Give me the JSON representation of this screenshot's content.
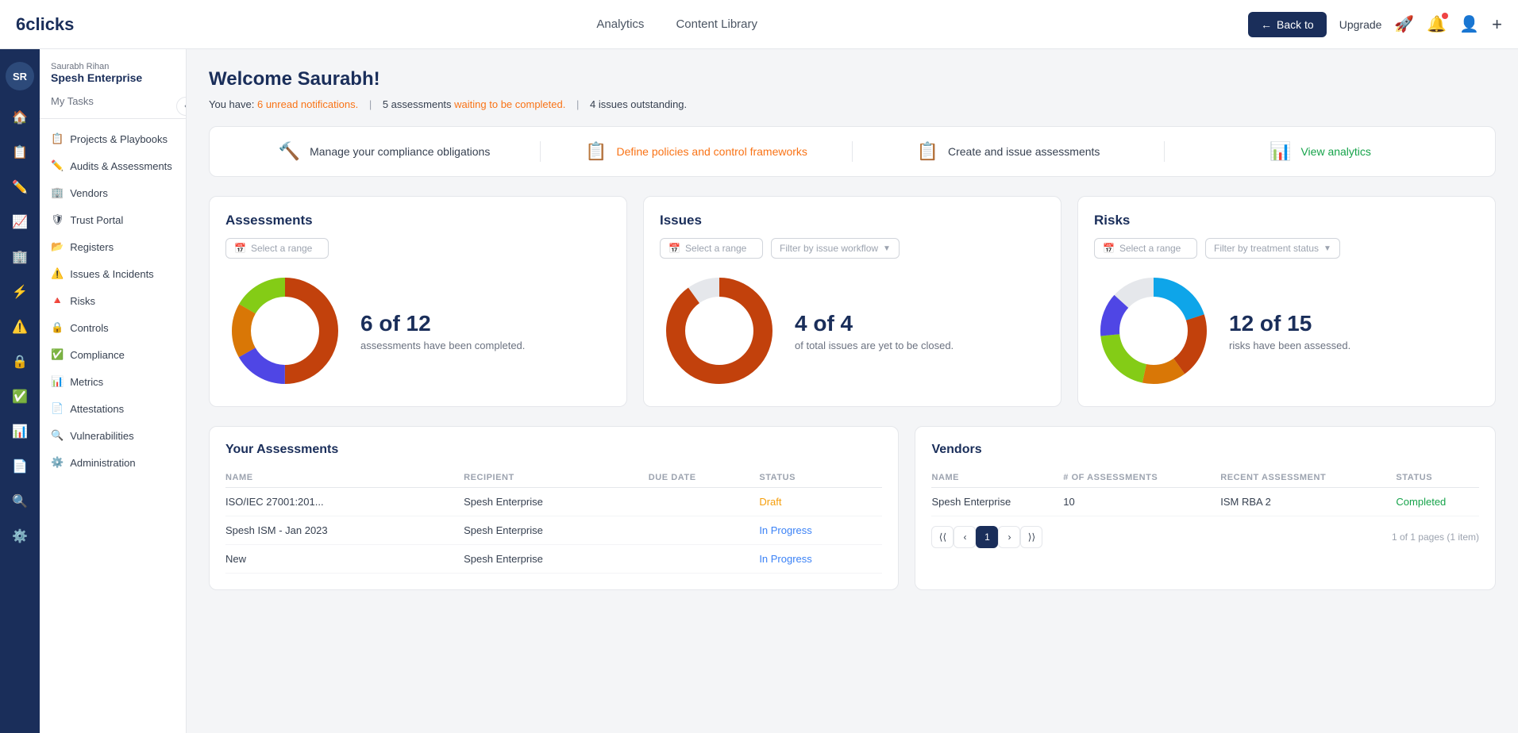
{
  "brand": {
    "name": "6clicks",
    "logo_text": "6clicks"
  },
  "nav": {
    "links": [
      "Analytics",
      "Content Library"
    ],
    "back_btn": "Back to",
    "upgrade_btn": "Upgrade",
    "plus_label": "+"
  },
  "user": {
    "initials": "SR",
    "name": "Saurabh Rihan",
    "org": "Spesh Enterprise",
    "my_tasks": "My Tasks"
  },
  "sidebar_nav": [
    {
      "label": "Projects & Playbooks",
      "icon": "📋"
    },
    {
      "label": "Audits & Assessments",
      "icon": "📝"
    },
    {
      "label": "Vendors",
      "icon": "🏢"
    },
    {
      "label": "Trust Portal",
      "icon": "🛡"
    },
    {
      "label": "Registers",
      "icon": "📂"
    },
    {
      "label": "Issues & Incidents",
      "icon": "⚠️"
    },
    {
      "label": "Risks",
      "icon": "🔺"
    },
    {
      "label": "Controls",
      "icon": "🔒"
    },
    {
      "label": "Compliance",
      "icon": "✅"
    },
    {
      "label": "Metrics",
      "icon": "📊"
    },
    {
      "label": "Attestations",
      "icon": "📄"
    },
    {
      "label": "Vulnerabilities",
      "icon": "🔍"
    },
    {
      "label": "Administration",
      "icon": "⚙️"
    }
  ],
  "welcome": {
    "title": "Welcome Saurabh!",
    "subtitle_prefix": "You have:",
    "notifications": "6 unread notifications.",
    "assessments_waiting": "5 assessments waiting to be completed.",
    "issues_outstanding": "4 issues outstanding."
  },
  "quick_actions": [
    {
      "label": "Manage your compliance obligations",
      "icon": "🔨"
    },
    {
      "label": "Define policies and control frameworks",
      "icon": "📋"
    },
    {
      "label": "Create and issue assessments",
      "icon": "📋"
    },
    {
      "label": "View analytics",
      "icon": "📊"
    }
  ],
  "assessments_card": {
    "title": "Assessments",
    "filter_placeholder": "Select a range",
    "stat_main": "6 of 12",
    "stat_desc": "assessments have been completed.",
    "donut": {
      "segments": [
        {
          "value": 6,
          "color": "#c2410c"
        },
        {
          "value": 2,
          "color": "#4f46e5"
        },
        {
          "value": 2,
          "color": "#d97706"
        },
        {
          "value": 2,
          "color": "#84cc16"
        }
      ]
    }
  },
  "issues_card": {
    "title": "Issues",
    "filter_placeholder": "Select a range",
    "filter2_placeholder": "Filter by issue workflow",
    "stat_main": "4 of 4",
    "stat_desc": "of total issues are yet to be closed.",
    "donut": {
      "segments": [
        {
          "value": 8,
          "color": "#c2410c"
        },
        {
          "value": 2,
          "color": "#e5e7eb"
        }
      ]
    }
  },
  "risks_card": {
    "title": "Risks",
    "filter_placeholder": "Select a range",
    "filter2_placeholder": "Filter by treatment status",
    "stat_main": "12 of 15",
    "stat_desc": "risks have been assessed.",
    "donut": {
      "segments": [
        {
          "value": 3,
          "color": "#0ea5e9"
        },
        {
          "value": 3,
          "color": "#c2410c"
        },
        {
          "value": 2,
          "color": "#d97706"
        },
        {
          "value": 3,
          "color": "#84cc16"
        },
        {
          "value": 2,
          "color": "#4f46e5"
        }
      ]
    }
  },
  "your_assessments": {
    "title": "Your Assessments",
    "columns": [
      "NAME",
      "RECIPIENT",
      "DUE DATE",
      "STATUS"
    ],
    "rows": [
      {
        "name": "ISO/IEC 27001:201...",
        "recipient": "Spesh Enterprise",
        "due_date": "",
        "status": "Draft",
        "status_class": "status-draft"
      },
      {
        "name": "Spesh ISM - Jan 2023",
        "recipient": "Spesh Enterprise",
        "due_date": "",
        "status": "In Progress",
        "status_class": "status-in-progress"
      },
      {
        "name": "New",
        "recipient": "Spesh Enterprise",
        "due_date": "",
        "status": "In Progress",
        "status_class": "status-in-progress"
      }
    ]
  },
  "vendors": {
    "title": "Vendors",
    "columns": [
      "NAME",
      "# OF ASSESSMENTS",
      "RECENT ASSESSMENT",
      "STATUS"
    ],
    "rows": [
      {
        "name": "Spesh Enterprise",
        "assessments": "10",
        "recent": "ISM RBA 2",
        "status": "Completed",
        "status_class": "status-completed"
      }
    ],
    "pagination": {
      "current": 1,
      "total_pages": 1,
      "total_items": 1,
      "info": "1 of 1 pages (1 item)"
    }
  }
}
